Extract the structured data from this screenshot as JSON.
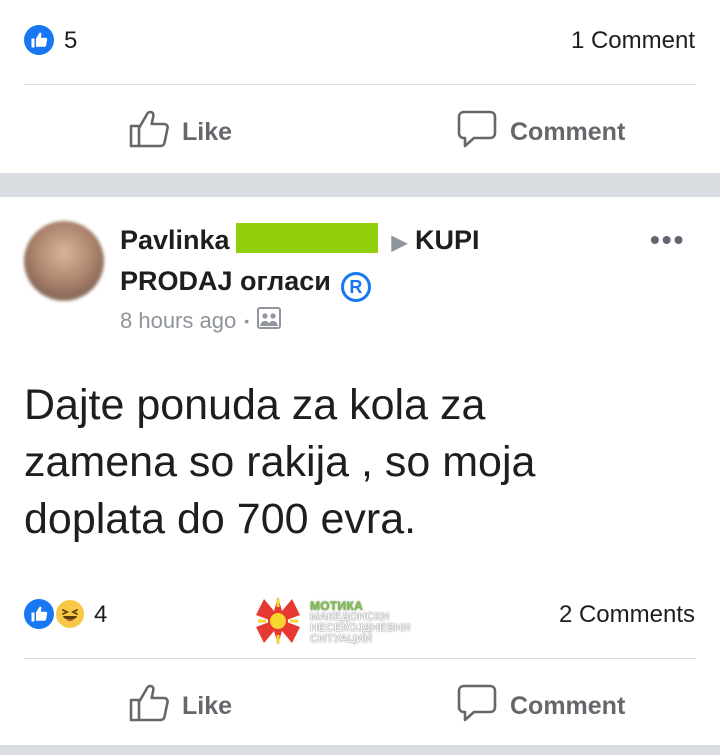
{
  "post1": {
    "like_count": "5",
    "comments_count": "1 Comment",
    "like_label": "Like",
    "comment_label": "Comment"
  },
  "post2": {
    "author_name": "Pavlinka",
    "group_name_line1": "KUPI",
    "group_name_line2": "PRODAJ огласи",
    "registered_mark": "R",
    "time": "8 hours ago",
    "separator": "•",
    "text_lines": [
      "Dajte ponuda za kola za",
      "zamena so rakija , so moja",
      "doplata do 700 evra."
    ],
    "reaction_count": "4",
    "comments_count": "2 Comments",
    "like_label": "Like",
    "comment_label": "Comment",
    "more": "•••",
    "watermark": {
      "brand": "МОТИКА",
      "line1": "МАКЕДОНСКИ",
      "line2": "НЕСЕКОЈДНЕВНИ",
      "line3": "СИТУАЦИИ"
    }
  },
  "colors": {
    "accent": "#1877f2",
    "muted": "#65676b",
    "redaction": "#92cf0c",
    "separator_band": "#dadde1"
  },
  "icons": [
    "like-reaction-icon",
    "haha-reaction-icon",
    "thumbs-up-icon",
    "comment-bubble-icon",
    "registered-icon",
    "audience-icon",
    "more-options-icon"
  ]
}
